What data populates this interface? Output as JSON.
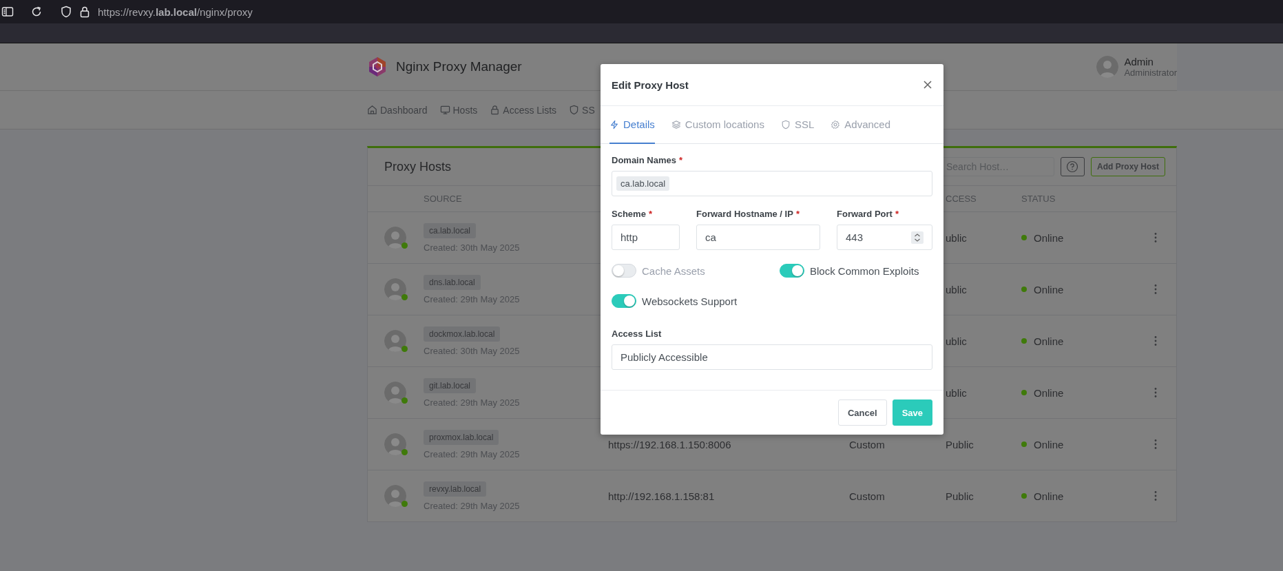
{
  "browser": {
    "url": "https://revxy.**lab.local**/nginx/proxy"
  },
  "header": {
    "app_name": "Nginx Proxy Manager",
    "user": {
      "name": "Admin",
      "role": "Administrator"
    }
  },
  "nav": [
    {
      "label": "Dashboard"
    },
    {
      "label": "Hosts"
    },
    {
      "label": "Access Lists"
    },
    {
      "label": "SS"
    }
  ],
  "card": {
    "title": "Proxy Hosts",
    "search_placeholder": "Search Host…",
    "add_button": "Add Proxy Host",
    "columns": {
      "source": "SOURCE",
      "access": "CCESS",
      "status": "STATUS"
    }
  },
  "rows": [
    {
      "domain": "ca.lab.local",
      "created": "Created: 30th May 2025",
      "access": "ublic",
      "status": "Online"
    },
    {
      "domain": "dns.lab.local",
      "created": "Created: 29th May 2025",
      "access": "ublic",
      "status": "Online"
    },
    {
      "domain": "dockmox.lab.local",
      "created": "Created: 30th May 2025",
      "access": "ublic",
      "status": "Online"
    },
    {
      "domain": "git.lab.local",
      "created": "Created: 29th May 2025",
      "access": "ublic",
      "status": "Online"
    },
    {
      "domain": "proxmox.lab.local",
      "created": "Created: 29th May 2025",
      "destination": "https://192.168.1.150:8006",
      "ssl": "Custom",
      "access": "Public",
      "status": "Online"
    },
    {
      "domain": "revxy.lab.local",
      "created": "Created: 29th May 2025",
      "destination": "http://192.168.1.158:81",
      "ssl": "Custom",
      "access": "Public",
      "status": "Online"
    }
  ],
  "modal": {
    "title": "Edit Proxy Host",
    "tabs": [
      {
        "label": "Details",
        "selected": true
      },
      {
        "label": "Custom locations",
        "selected": false
      },
      {
        "label": "SSL",
        "selected": false
      },
      {
        "label": "Advanced",
        "selected": false
      }
    ],
    "domain_names": {
      "label": "Domain Names",
      "mark": "*",
      "tags": [
        "ca.lab.local"
      ]
    },
    "fields": [
      {
        "label": "Scheme",
        "mark": "*",
        "value": "http",
        "kind": "text"
      },
      {
        "label": "Forward Hostname / IP",
        "mark": "*",
        "value": "ca",
        "kind": "text"
      },
      {
        "label": "Forward Port",
        "mark": "*",
        "value": "443",
        "kind": "number"
      }
    ],
    "toggles": [
      {
        "label": "Cache Assets",
        "on": false
      },
      {
        "label": "Block Common Exploits",
        "on": true
      },
      {
        "label": "Websockets Support",
        "on": true
      }
    ],
    "access_list": {
      "label": "Access List",
      "value": "Publicly Accessible"
    },
    "buttons": {
      "cancel": "Cancel",
      "save": "Save"
    }
  }
}
